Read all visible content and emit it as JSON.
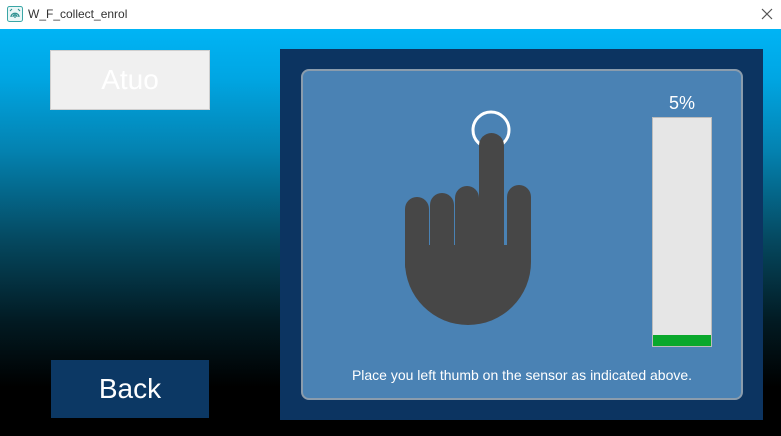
{
  "window": {
    "title": "W_F_collect_enrol",
    "icon": "fingerprint-app-icon",
    "close_icon": "close-icon"
  },
  "left_panel": {
    "auto_label": "Atuo",
    "back_label": "Back"
  },
  "enrollment": {
    "progress_text": "5%",
    "progress_value": 0.05,
    "instruction": "Place you left thumb on the sensor as indicated above.",
    "hand_icon": "pointing-hand-icon",
    "target_icon": "touch-ring-icon"
  },
  "colors": {
    "accent_top": "#00b4f5",
    "panel_dark": "#0c3461",
    "panel_inner": "#4a82b4",
    "hand": "#474747",
    "progress_fill": "#0aa82c",
    "back_button": "#0c3864"
  }
}
